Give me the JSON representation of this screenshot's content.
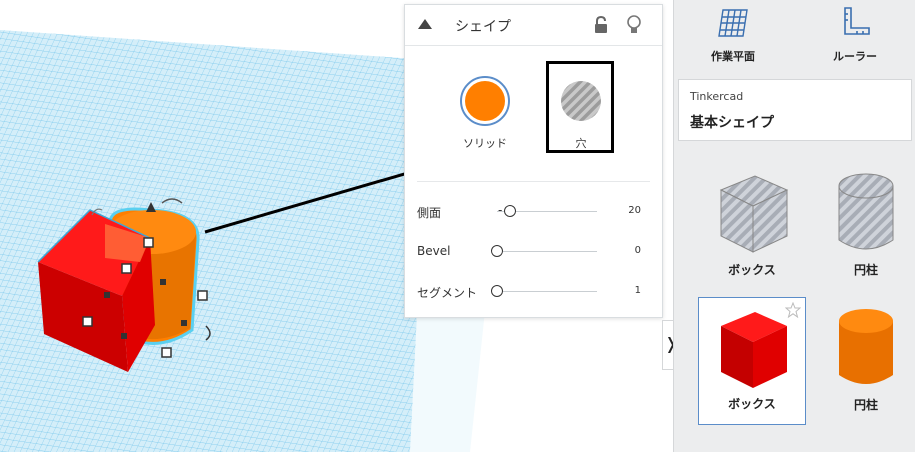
{
  "inspector": {
    "title": "シェイプ",
    "solid_label": "ソリッド",
    "hole_label": "穴",
    "properties": [
      {
        "label": "側面",
        "value": "20"
      },
      {
        "label": "Bevel",
        "value": "0"
      },
      {
        "label": "セグメント",
        "value": "1"
      }
    ]
  },
  "library": {
    "workplane_label": "作業平面",
    "ruler_label": "ルーラー",
    "source": "Tinkercad",
    "category": "基本シェイプ",
    "shapes": [
      {
        "label": "ボックス",
        "type": "box-hole"
      },
      {
        "label": "円柱",
        "type": "cylinder-hole"
      },
      {
        "label": "ボックス",
        "type": "box-solid"
      },
      {
        "label": "円柱",
        "type": "cylinder-solid"
      }
    ],
    "expand_glyph": "❭"
  },
  "colors": {
    "solid_orange": "#ff7f00",
    "box_red": "#e10000",
    "grid": "#4fb6e3",
    "selection_border": "#5b8dc9"
  }
}
